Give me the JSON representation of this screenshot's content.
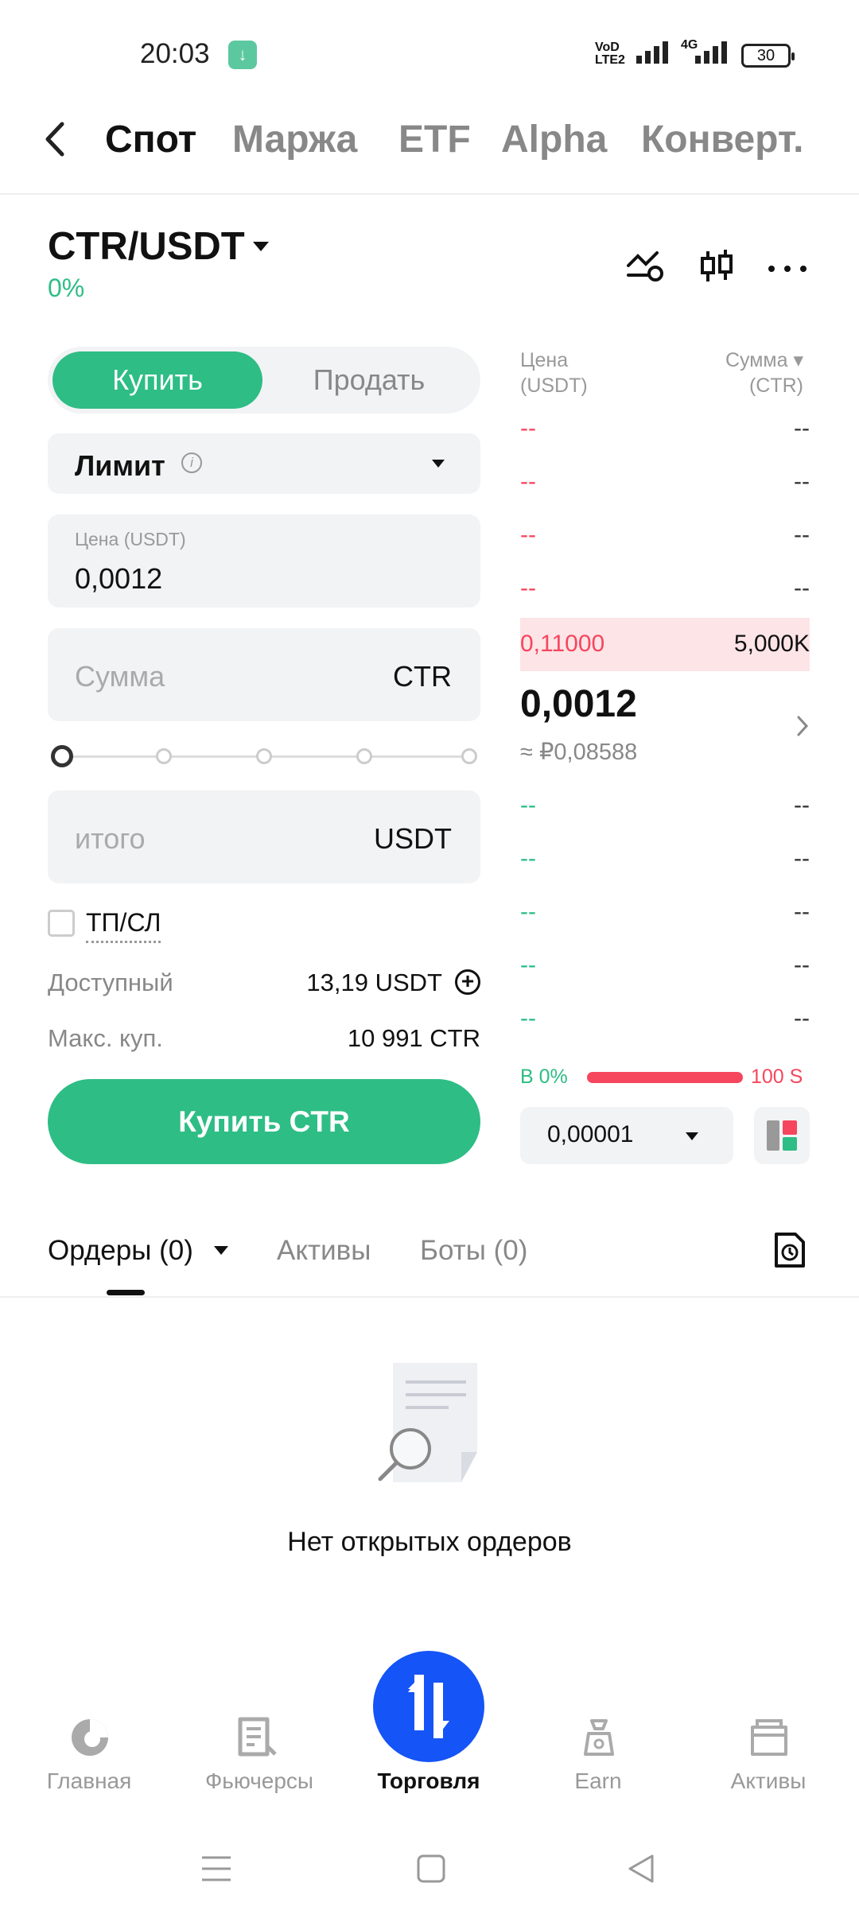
{
  "status_bar": {
    "time": "20:03",
    "network": "VoLTE2",
    "network_type": "4G",
    "battery": "30"
  },
  "top_tabs": [
    "Спот",
    "Маржа",
    "ETF",
    "Alpha",
    "Конверт."
  ],
  "pair": {
    "symbol": "CTR/USDT",
    "change": "0%"
  },
  "form": {
    "buy_label": "Купить",
    "sell_label": "Продать",
    "order_type": "Лимит",
    "price_label": "Цена (USDT)",
    "price_value": "0,0012",
    "amount_placeholder": "Сумма",
    "amount_unit": "CTR",
    "total_placeholder": "итого",
    "total_unit": "USDT",
    "tpsl_label": "ТП/СЛ",
    "available_label": "Доступный",
    "available_value": "13,19 USDT",
    "max_buy_label": "Макс. куп.",
    "max_buy_value": "10 991 CTR",
    "submit_label": "Купить CTR"
  },
  "order_book": {
    "price_header": "Цена\n(USDT)",
    "amount_header": "Сумма ▾\n(CTR)",
    "asks": [
      {
        "price": "--",
        "amount": "--"
      },
      {
        "price": "--",
        "amount": "--"
      },
      {
        "price": "--",
        "amount": "--"
      },
      {
        "price": "--",
        "amount": "--"
      }
    ],
    "best_ask": {
      "price": "0,11000",
      "amount": "5,000K"
    },
    "last_price": "0,0012",
    "last_price_fiat": "≈ ₽0,08588",
    "bids": [
      {
        "price": "--",
        "amount": "--"
      },
      {
        "price": "--",
        "amount": "--"
      },
      {
        "price": "--",
        "amount": "--"
      },
      {
        "price": "--",
        "amount": "--"
      },
      {
        "price": "--",
        "amount": "--"
      }
    ],
    "ratio_buy": "B 0%",
    "ratio_sell": "100  S",
    "step": "0,00001"
  },
  "orders_tabs": {
    "orders": "Ордеры (0)",
    "assets": "Активы",
    "bots": "Боты (0)"
  },
  "empty_message": "Нет открытых ордеров",
  "bottom_nav": [
    "Главная",
    "Фьючерсы",
    "Торговля",
    "Earn",
    "Активы"
  ],
  "colors": {
    "green": "#2ebd85",
    "red": "#f6465d",
    "fab_blue": "#1554f6"
  }
}
